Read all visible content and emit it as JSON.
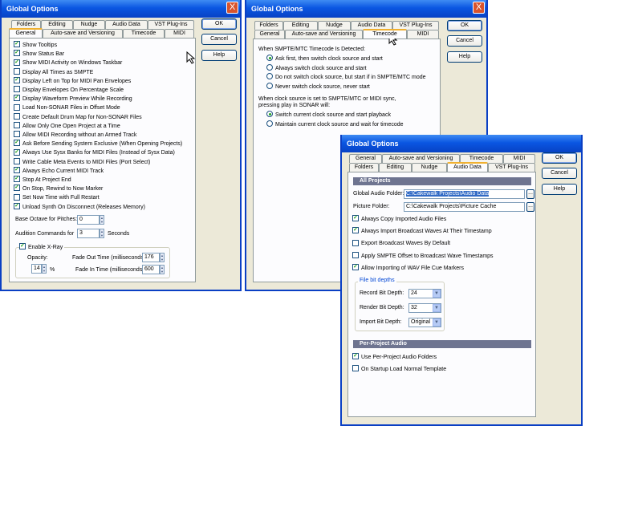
{
  "window1": {
    "title": "Global Options",
    "close": "X",
    "tabs_back": [
      "Folders",
      "Editing",
      "Nudge",
      "Audio Data",
      "VST Plug-Ins"
    ],
    "tabs_front": [
      "General",
      "Auto-save and Versioning",
      "Timecode",
      "MIDI"
    ],
    "buttons": {
      "ok": "OK",
      "cancel": "Cancel",
      "help": "Help"
    },
    "checkboxes": [
      {
        "label": "Show Tooltips",
        "checked": true
      },
      {
        "label": "Show Status Bar",
        "checked": true
      },
      {
        "label": "Show MIDI Activity on Windows Taskbar",
        "checked": true
      },
      {
        "label": "Display All Times as SMPTE",
        "checked": false
      },
      {
        "label": "Display Left on Top for MIDI Pan Envelopes",
        "checked": true
      },
      {
        "label": "Display Envelopes On Percentage Scale",
        "checked": false
      },
      {
        "label": "Display Waveform Preview While Recording",
        "checked": true
      },
      {
        "label": "Load Non-SONAR Files in Offset Mode",
        "checked": false
      },
      {
        "label": "Create Default Drum Map for Non-SONAR Files",
        "checked": false
      },
      {
        "label": "Allow Only One Open Project at a Time",
        "checked": false
      },
      {
        "label": "Allow MIDI Recording without an Armed Track",
        "checked": false
      },
      {
        "label": "Ask Before Sending System Exclusive (When Opening Projects)",
        "checked": true
      },
      {
        "label": "Always Use Sysx Banks for MIDI Files (Instead of Sysx Data)",
        "checked": true
      },
      {
        "label": "Write Cable Meta Events to MIDI Files (Port Select)",
        "checked": false
      },
      {
        "label": "Always Echo Current MIDI Track",
        "checked": true
      },
      {
        "label": "Stop At Project End",
        "checked": true
      },
      {
        "label": "On Stop, Rewind to Now Marker",
        "checked": true
      },
      {
        "label": "Set Now Time with Full Restart",
        "checked": false
      },
      {
        "label": "Unload Synth On Disconnect (Releases Memory)",
        "checked": true
      }
    ],
    "base_octave_label": "Base Octave for Pitches:",
    "base_octave_value": "0",
    "audition_label": "Audition Commands for",
    "audition_value": "3",
    "audition_unit": "Seconds",
    "xray_label": "Enable X-Ray",
    "xray_checked": true,
    "opacity_label": "Opacity:",
    "opacity_value": "14",
    "opacity_unit": "%",
    "fade_out_label": "Fade Out Time (milliseconds):",
    "fade_out_value": "176",
    "fade_in_label": "Fade In Time (milliseconds):",
    "fade_in_value": "600"
  },
  "window2": {
    "title": "Global Options",
    "close": "X",
    "tabs_back": [
      "Folders",
      "Editing",
      "Nudge",
      "Audio Data",
      "VST Plug-Ins"
    ],
    "tabs_front": [
      "General",
      "Auto-save and Versioning",
      "Timecode",
      "MIDI"
    ],
    "buttons": {
      "ok": "OK",
      "cancel": "Cancel",
      "help": "Help"
    },
    "heading1": "When SMPTE/MTC Timecode Is Detected:",
    "radios1": [
      {
        "label": "Ask first, then switch clock source and start",
        "on": true
      },
      {
        "label": "Always switch clock source and start",
        "on": false
      },
      {
        "label": "Do not switch clock source, but start if in SMPTE/MTC mode",
        "on": false
      },
      {
        "label": "Never switch clock source, never start",
        "on": false
      }
    ],
    "heading2_line1": "When clock source is set to SMPTE/MTC or MIDI sync,",
    "heading2_line2": "pressing play in SONAR will:",
    "radios2": [
      {
        "label": "Switch current clock source and start playback",
        "on": true
      },
      {
        "label": "Maintain current clock source and wait for timecode",
        "on": false
      }
    ]
  },
  "window3": {
    "title": "Global Options",
    "close": "X",
    "tabs_back": [
      "General",
      "Auto-save and Versioning",
      "Timecode",
      "MIDI"
    ],
    "tabs_front": [
      "Folders",
      "Editing",
      "Nudge",
      "Audio Data",
      "VST Plug-Ins"
    ],
    "buttons": {
      "ok": "OK",
      "cancel": "Cancel",
      "help": "Help"
    },
    "section_all": "All Projects",
    "global_folder_label": "Global Audio Folder:",
    "global_folder_value": "C:\\Cakewalk Projects\\Audio Data",
    "picture_folder_label": "Picture Folder:",
    "picture_folder_value": "C:\\Cakewalk Projects\\Picture Cache",
    "browse": "...",
    "checkboxes": [
      {
        "label": "Always Copy Imported Audio Files",
        "checked": true
      },
      {
        "label": "Always Import Broadcast Waves At Their Timestamp",
        "checked": true
      },
      {
        "label": "Export Broadcast Waves By Default",
        "checked": false
      },
      {
        "label": "Apply SMPTE Offset to Broadcast Wave Timestamps",
        "checked": false
      },
      {
        "label": "Allow Importing of WAV File Cue Markers",
        "checked": true
      }
    ],
    "bitdepth_group": "File bit depths",
    "record_label": "Record Bit Depth:",
    "record_value": "24",
    "render_label": "Render Bit Depth:",
    "render_value": "32",
    "import_label": "Import Bit Depth:",
    "import_value": "Original",
    "section_per": "Per-Project Audio",
    "per_checkboxes": [
      {
        "label": "Use Per-Project Audio Folders",
        "checked": true
      },
      {
        "label": "On Startup Load Normal Template",
        "checked": false
      }
    ]
  }
}
